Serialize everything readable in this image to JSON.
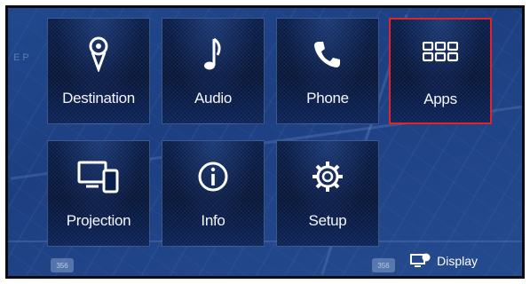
{
  "tiles": [
    {
      "label": "Destination",
      "icon": "map-pin-icon",
      "selected": false
    },
    {
      "label": "Audio",
      "icon": "music-note-icon",
      "selected": false
    },
    {
      "label": "Phone",
      "icon": "phone-handset-icon",
      "selected": false
    },
    {
      "label": "Apps",
      "icon": "app-grid-icon",
      "selected": true
    },
    {
      "label": "Projection",
      "icon": "screen-projection-icon",
      "selected": false
    },
    {
      "label": "Info",
      "icon": "info-icon",
      "selected": false
    },
    {
      "label": "Setup",
      "icon": "gear-icon",
      "selected": false
    }
  ],
  "display_button": {
    "label": "Display",
    "icon": "display-icon"
  },
  "map_labels": {
    "corner_text": "E P",
    "shield_left": "356",
    "shield_right": "356"
  },
  "colors": {
    "background": "#1d3f82",
    "tile": "#071538",
    "selected_border": "#e2232a",
    "text": "#ffffff"
  }
}
